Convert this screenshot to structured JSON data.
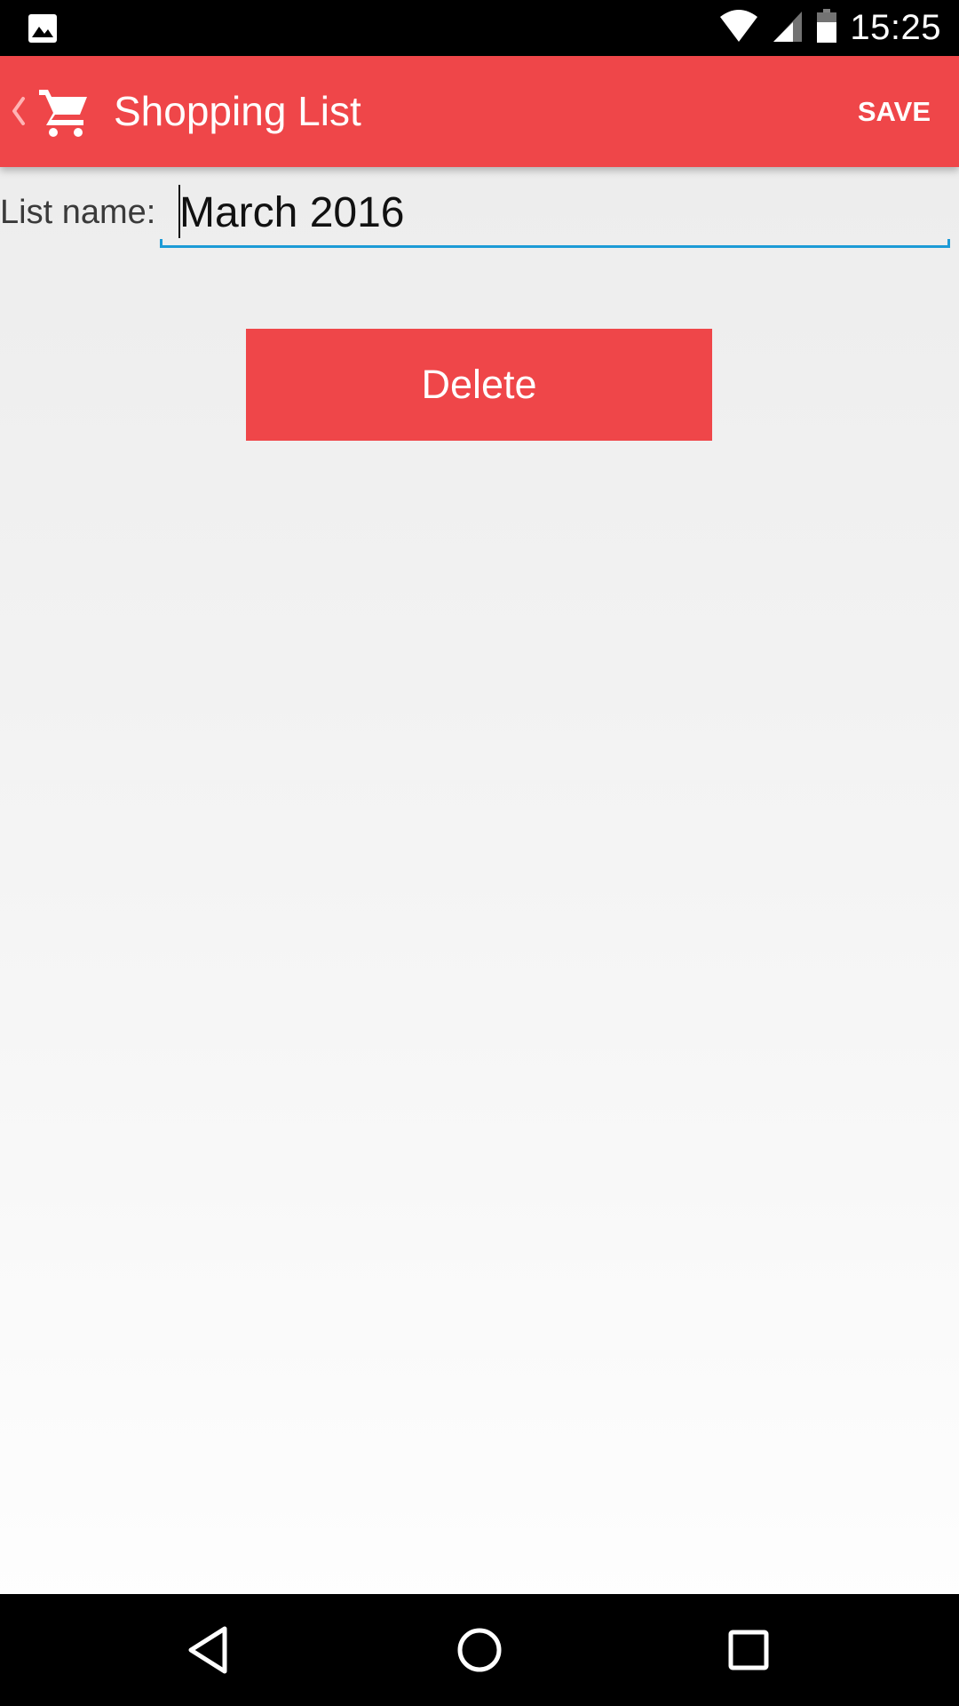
{
  "status_bar": {
    "time": "15:25",
    "left_icon": "image-notification-icon",
    "icons": [
      "wifi-icon",
      "cellular-signal-icon",
      "battery-icon"
    ]
  },
  "app_bar": {
    "title": "Shopping List",
    "save_label": "SAVE",
    "background_color": "#ef4649",
    "nav_icon": "back-chevron-icon",
    "app_icon": "shopping-cart-icon"
  },
  "form": {
    "list_name_label": "List name:",
    "list_name_value": "March 2016",
    "focus_color": "#1d9bd6"
  },
  "actions": {
    "delete_label": "Delete",
    "delete_color": "#ef4649"
  },
  "nav_bar": {
    "buttons": [
      "back-triangle-icon",
      "home-circle-icon",
      "recents-square-icon"
    ]
  }
}
